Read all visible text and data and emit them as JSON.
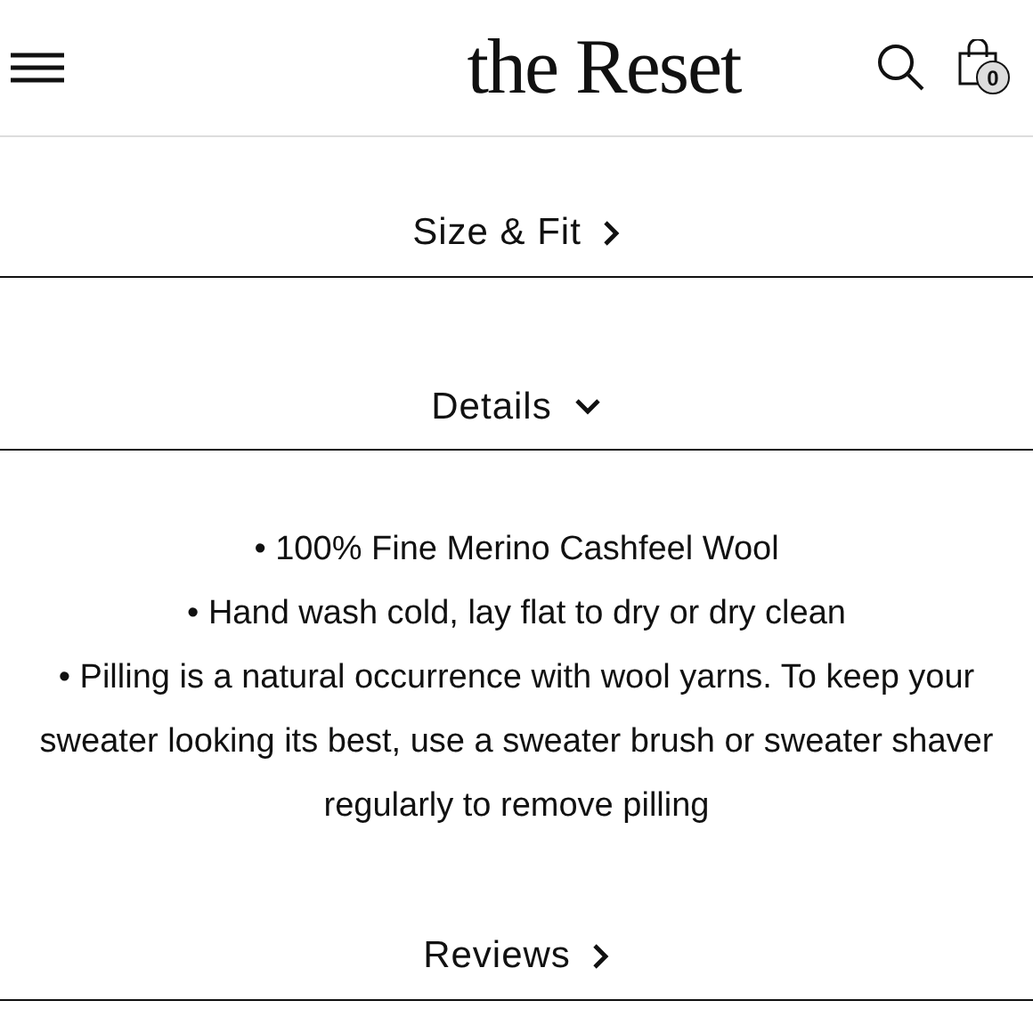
{
  "header": {
    "logo": "the Reset",
    "cart_count": "0"
  },
  "sections": [
    {
      "title": "Size & Fit",
      "expanded": false
    },
    {
      "title": "Details",
      "expanded": true,
      "bullets": [
        "• 100% Fine Merino Cashfeel Wool",
        "• Hand wash cold, lay flat to dry or dry clean",
        "• Pilling is a natural occurrence with wool yarns. To keep your sweater looking its best, use a sweater brush or sweater shaver regularly to remove pilling"
      ]
    },
    {
      "title": "Reviews",
      "expanded": false
    }
  ]
}
